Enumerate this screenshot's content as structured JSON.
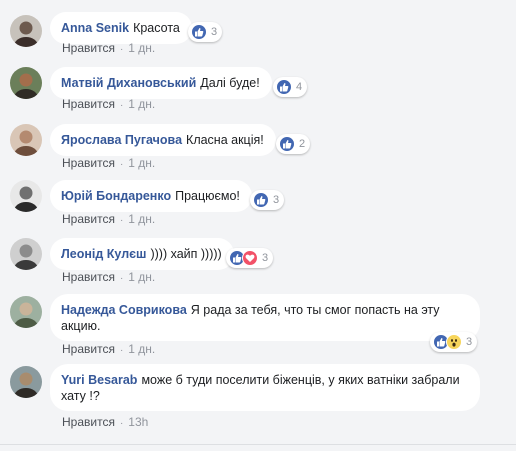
{
  "comments": [
    {
      "author": "Anna Senik",
      "text": "Красота",
      "reaction_count": "3",
      "reactions": [
        "like"
      ],
      "like_label": "Нравится",
      "time": "1 дн.",
      "avatar_colors": [
        "#c7c2bb",
        "#3b2e2a",
        "#6d5a4e"
      ]
    },
    {
      "author": "Матвій Дихановський",
      "text": "Далі буде!",
      "reaction_count": "4",
      "reactions": [
        "like"
      ],
      "like_label": "Нравится",
      "time": "1 дн.",
      "avatar_colors": [
        "#6b7f5a",
        "#2f2b25",
        "#a36e4c"
      ]
    },
    {
      "author": "Ярослава Пугачова",
      "text": "Класна акція!",
      "reaction_count": "2",
      "reactions": [
        "like"
      ],
      "like_label": "Нравится",
      "time": "1 дн.",
      "avatar_colors": [
        "#d9c6b6",
        "#6e4e3c",
        "#b48a70"
      ]
    },
    {
      "author": "Юрій Бондаренко",
      "text": "Працюємо!",
      "reaction_count": "3",
      "reactions": [
        "like"
      ],
      "like_label": "Нравится",
      "time": "1 дн.",
      "avatar_colors": [
        "#e8e8e8",
        "#2a2a2a",
        "#707070"
      ]
    },
    {
      "author": "Леонід Кулєш",
      "text": ")))) хайп )))))",
      "reaction_count": "3",
      "reactions": [
        "like",
        "love"
      ],
      "like_label": "Нравится",
      "time": "1 дн.",
      "avatar_colors": [
        "#cfcfcf",
        "#3a3a3a",
        "#8c8c8c"
      ]
    },
    {
      "author": "Надежда Соврикова",
      "text": "Я рада за тебя, что ты смог попасть на эту акцию.",
      "reaction_count": "3",
      "reactions": [
        "like",
        "wow"
      ],
      "like_label": "Нравится",
      "time": "1 дн.",
      "avatar_colors": [
        "#9db0a0",
        "#4d5b45",
        "#c9b49a"
      ]
    },
    {
      "author": "Yuri Besarab",
      "text": "може б туди поселити біженців, у яких ватніки забрали хату !?",
      "reaction_count": "",
      "reactions": [],
      "like_label": "Нравится",
      "time": "13h",
      "avatar_colors": [
        "#8a9a9e",
        "#2e2a26",
        "#a88c6e"
      ]
    }
  ],
  "colors": {
    "author_link": "#365899",
    "like_blue": "#4267b2",
    "love_red": "#f25268",
    "wow_yellow": "#f7d55b",
    "muted": "#90949c"
  }
}
